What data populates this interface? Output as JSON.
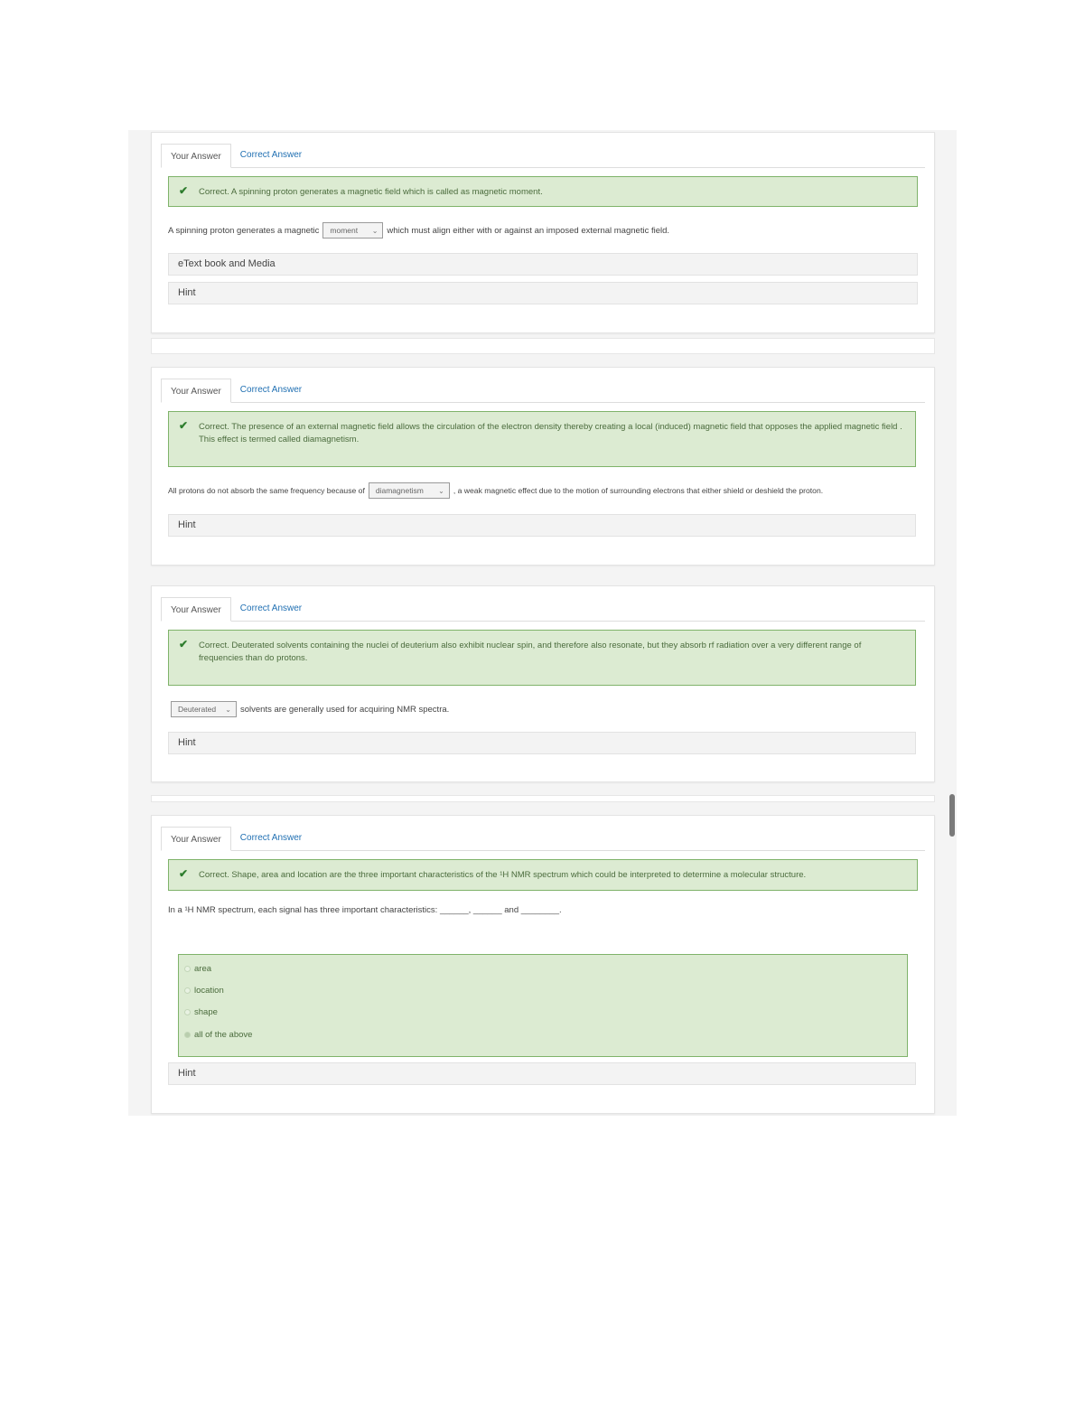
{
  "tabs": {
    "your_answer": "Your Answer",
    "correct_answer": "Correct Answer"
  },
  "icons": {
    "check": "check-icon",
    "caret": "chevron-down-icon"
  },
  "colors": {
    "feedback_bg": "#dcebd2",
    "feedback_border": "#7fb36a",
    "link": "#1f6fb2"
  },
  "q1": {
    "feedback": "Correct. A spinning proton generates a magnetic field which is called as magnetic moment.",
    "text_before": "A spinning proton generates a magnetic",
    "select_value": "moment",
    "text_after": "which must align either with or against an imposed external magnetic field.",
    "etextbook": "eText book and Media",
    "hint": "Hint"
  },
  "q2": {
    "feedback": "Correct. The presence of an external magnetic field allows the circulation of the electron density thereby creating a local (induced) magnetic field that opposes the applied magnetic field . This effect is termed called diamagnetism.",
    "text_before": "All protons do not absorb the same frequency because of",
    "select_value": "diamagnetism",
    "text_after": ", a weak magnetic effect due to the motion of surrounding electrons that either shield or deshield the proton.",
    "hint": "Hint"
  },
  "q3": {
    "feedback": "Correct. Deuterated solvents containing the nuclei of deuterium also exhibit nuclear spin, and therefore also resonate, but they absorb rf radiation over a very different range of frequencies than do protons.",
    "select_value": "Deuterated",
    "text_after": "solvents are generally used for acquiring NMR spectra.",
    "hint": "Hint"
  },
  "q4": {
    "feedback": "Correct. Shape, area and location are the three important characteristics of the ¹H NMR spectrum which could be interpreted to determine a molecular structure.",
    "question": "In a ¹H NMR spectrum, each signal has three important characteristics: ______, ______ and ________.",
    "options": [
      "area",
      "location",
      "shape",
      "all of the above"
    ],
    "selected_index": 3,
    "hint": "Hint"
  }
}
